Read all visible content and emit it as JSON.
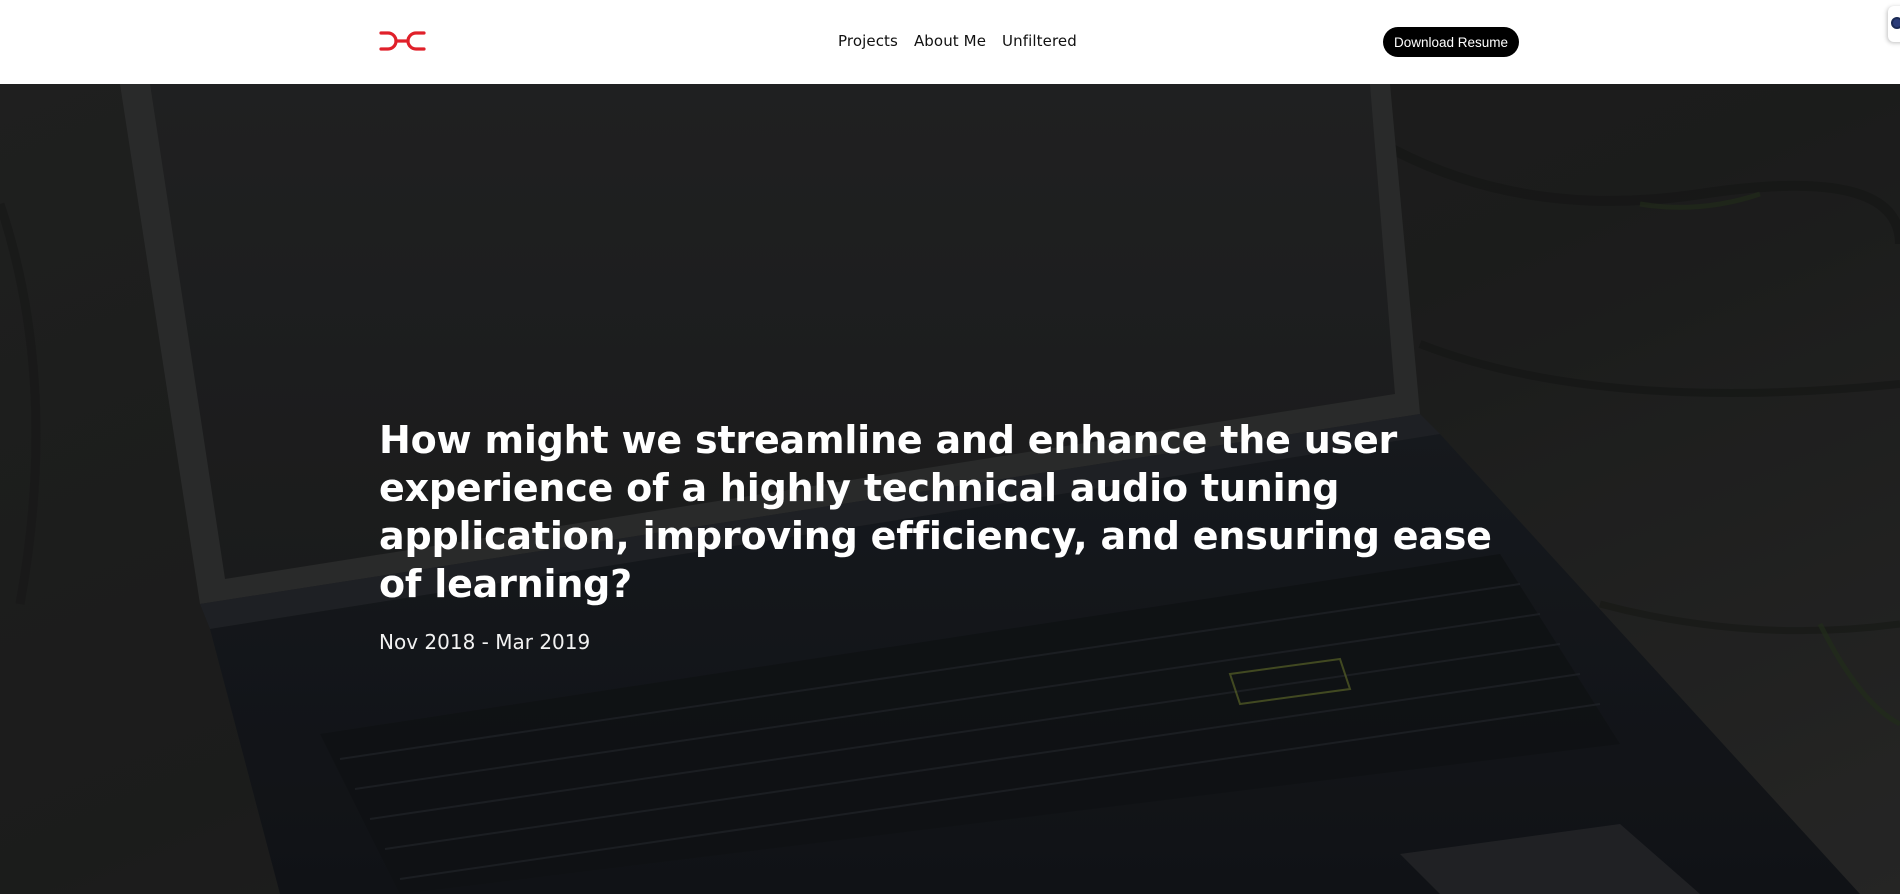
{
  "nav": {
    "logo_icon": "ds-monogram-icon",
    "links": [
      "Projects",
      "About Me",
      "Unfiltered"
    ],
    "resume_label": "Download Resume"
  },
  "hero": {
    "title": "How might we streamline and enhance the user experience of a highly technical audio tuning application, improving efficiency, and ensuring ease of learning?",
    "dates": "Nov 2018 - Mar 2019",
    "background": "darkened-laptop-photo"
  },
  "colors": {
    "accent": "#e0202a",
    "nav_bg": "#ffffff",
    "button_bg": "#000000",
    "hero_text": "#ffffff"
  }
}
